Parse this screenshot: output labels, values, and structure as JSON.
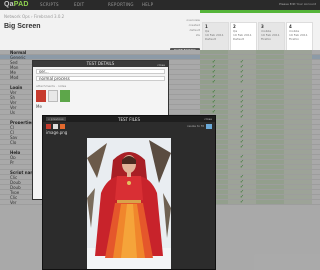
{
  "app": {
    "logo_prefix": "Qa",
    "logo_suffix": "PAD",
    "top_right": "Please Edit Your Account"
  },
  "nav": [
    "SCRIPTS",
    "EDIT",
    "REPORTING",
    "HELP"
  ],
  "header": {
    "breadcrumb": "Network Ops  ›  Firebrand 3.0.2",
    "title": "Big Screen",
    "meta": [
      "overview",
      "created",
      "default",
      "ids"
    ],
    "button": "DONE EDITING",
    "columns": [
      {
        "title": "1",
        "lines": [
          "Qa",
          "19 Feb 2011",
          "Default"
        ]
      },
      {
        "title": "2",
        "lines": [
          "Qa",
          "19 Feb 2011",
          "Default"
        ]
      },
      {
        "title": "3",
        "lines": [
          "mobile",
          "19 Feb 2011",
          "Firefox"
        ]
      },
      {
        "title": "4",
        "lines": [
          "mobile",
          "19 Feb 2011",
          "Firefox"
        ]
      }
    ]
  },
  "grid": {
    "rows": [
      {
        "num": "",
        "name": "Normal",
        "section": true,
        "checks": [
          0,
          0,
          0,
          0
        ]
      },
      {
        "num": "",
        "name": "Generic",
        "hl": true,
        "checks": [
          0,
          0,
          0,
          0
        ]
      },
      {
        "num": "",
        "name": "Sed",
        "checks": [
          1,
          1,
          0,
          0
        ]
      },
      {
        "num": "",
        "name": "Mon",
        "checks": [
          1,
          1,
          0,
          0
        ]
      },
      {
        "num": "",
        "name": "Me",
        "checks": [
          1,
          1,
          0,
          0
        ]
      },
      {
        "num": "",
        "name": "Mod",
        "checks": [
          1,
          1,
          0,
          0
        ]
      },
      {
        "num": "",
        "name": "",
        "checks": [
          1,
          1,
          0,
          0
        ]
      },
      {
        "num": "",
        "name": "Login",
        "section": true,
        "checks": [
          0,
          0,
          0,
          0
        ]
      },
      {
        "num": "",
        "name": "Ver",
        "checks": [
          1,
          1,
          0,
          0
        ]
      },
      {
        "num": "",
        "name": "Sh",
        "checks": [
          1,
          1,
          0,
          0
        ]
      },
      {
        "num": "",
        "name": "Ver",
        "checks": [
          1,
          1,
          0,
          0
        ]
      },
      {
        "num": "",
        "name": "Ver",
        "checks": [
          1,
          1,
          0,
          0
        ]
      },
      {
        "num": "",
        "name": "Us",
        "checks": [
          1,
          1,
          0,
          0
        ]
      },
      {
        "num": "",
        "name": "",
        "checks": [
          1,
          1,
          0,
          0
        ]
      },
      {
        "num": "",
        "name": "Properties",
        "section": true,
        "checks": [
          0,
          0,
          0,
          0
        ]
      },
      {
        "num": "",
        "name": "Cl",
        "checks": [
          1,
          1,
          0,
          0
        ]
      },
      {
        "num": "",
        "name": "Cl",
        "checks": [
          1,
          1,
          0,
          0
        ]
      },
      {
        "num": "",
        "name": "Sav",
        "checks": [
          1,
          1,
          0,
          0
        ]
      },
      {
        "num": "",
        "name": "Clo",
        "checks": [
          1,
          1,
          0,
          0
        ]
      },
      {
        "num": "",
        "name": "",
        "checks": [
          1,
          1,
          0,
          0
        ]
      },
      {
        "num": "",
        "name": "Help",
        "section": true,
        "checks": [
          0,
          0,
          0,
          0
        ]
      },
      {
        "num": "",
        "name": "Op",
        "checks": [
          1,
          1,
          0,
          0
        ]
      },
      {
        "num": "",
        "name": "Pr",
        "checks": [
          1,
          1,
          0,
          0
        ]
      },
      {
        "num": "",
        "name": "",
        "checks": [
          1,
          1,
          0,
          0
        ]
      },
      {
        "num": "",
        "name": "Script name",
        "section": true,
        "checks": [
          0,
          0,
          0,
          0
        ]
      },
      {
        "num": "",
        "name": "Clic",
        "checks": [
          1,
          1,
          0,
          0
        ]
      },
      {
        "num": "",
        "name": "Doub",
        "checks": [
          1,
          1,
          0,
          0
        ]
      },
      {
        "num": "",
        "name": "Doub",
        "checks": [
          1,
          1,
          0,
          0
        ]
      },
      {
        "num": "",
        "name": "Type",
        "checks": [
          1,
          1,
          0,
          0
        ]
      },
      {
        "num": "",
        "name": "Clic",
        "checks": [
          1,
          1,
          0,
          0
        ]
      },
      {
        "num": "",
        "name": "Ver",
        "checks": [
          1,
          1,
          0,
          0
        ]
      }
    ]
  },
  "back_modal": {
    "title": "TEST DETAILS",
    "close": "close",
    "field1": "ser...",
    "field2": "normal process",
    "sub": "attachments · notes",
    "text": "Me"
  },
  "modal": {
    "title": "TEST FILES",
    "prev": "« previous",
    "close": "close",
    "filename": "image.png",
    "zoom_label": "resize to fit"
  },
  "colors": {
    "accent_green": "#55b53a",
    "check_green": "#3fa43a",
    "highlight": "#cfe4f7",
    "dress_red": "#c8232b"
  }
}
